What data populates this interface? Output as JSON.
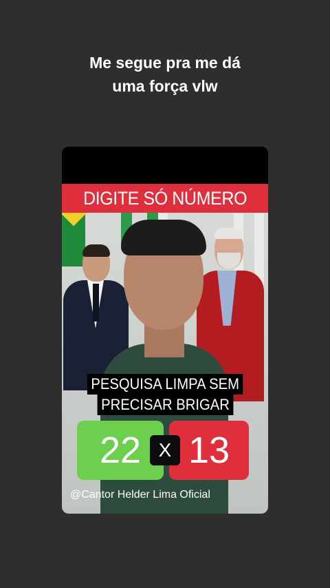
{
  "caption": {
    "line1": "Me segue pra me dá",
    "line2": "uma força vlw"
  },
  "video": {
    "top_banner": "DIGITE SÓ NÚMERO",
    "headline_line1": "PESQUISA LIMPA SEM",
    "headline_line2": "PRECISAR BRIGAR",
    "score_left": "22",
    "score_separator": "X",
    "score_right": "13",
    "watermark": "@Cantor Helder Lima Oficial"
  },
  "colors": {
    "background": "#2f2e2e",
    "banner_red": "#df2f3d",
    "score_green": "#6dcf4e",
    "score_red": "#df2f3d"
  }
}
